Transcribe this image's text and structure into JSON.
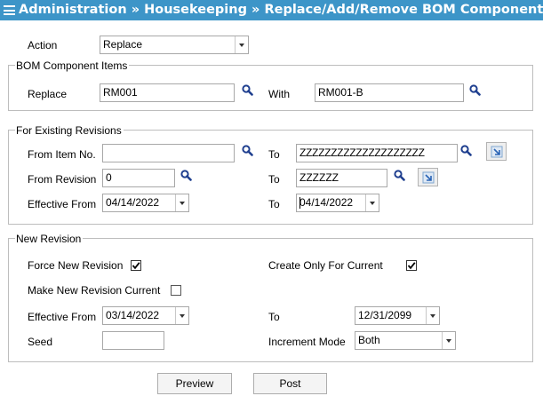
{
  "window": {
    "title": "Administration » Housekeeping » Replace/Add/Remove BOM Component"
  },
  "action": {
    "label": "Action",
    "value": "Replace"
  },
  "bom_items": {
    "legend": "BOM Component Items",
    "replace_label": "Replace",
    "replace_value": "RM001",
    "with_label": "With",
    "with_value": "RM001-B"
  },
  "existing": {
    "legend": "For Existing Revisions",
    "from_item_label": "From Item No.",
    "from_item_value": "",
    "to_item_label": "To",
    "to_item_value": "ZZZZZZZZZZZZZZZZZZZZ",
    "from_rev_label": "From Revision",
    "from_rev_value": "0",
    "to_rev_label": "To",
    "to_rev_value": "ZZZZZZ",
    "eff_from_label": "Effective From",
    "eff_from_value": "04/14/2022",
    "eff_to_label": "To",
    "eff_to_value": "04/14/2022"
  },
  "new_revision": {
    "legend": "New Revision",
    "force_label": "Force New Revision",
    "force_checked": true,
    "create_current_label": "Create Only For Current",
    "create_current_checked": true,
    "make_current_label": "Make New Revision Current",
    "make_current_checked": false,
    "eff_from_label": "Effective From",
    "eff_from_value": "03/14/2022",
    "eff_to_label": "To",
    "eff_to_value": "12/31/2099",
    "seed_label": "Seed",
    "seed_value": "",
    "increment_label": "Increment Mode",
    "increment_value": "Both"
  },
  "buttons": {
    "preview": "Preview",
    "post": "Post"
  },
  "icons": {
    "menu": "hamburger-menu-icon",
    "lookup": "magnifier-icon",
    "copy": "copy-range-icon",
    "check": "checkmark-icon"
  },
  "colors": {
    "titlebar": "#3d95c8",
    "lookup_icon": "#1f3f8f"
  }
}
